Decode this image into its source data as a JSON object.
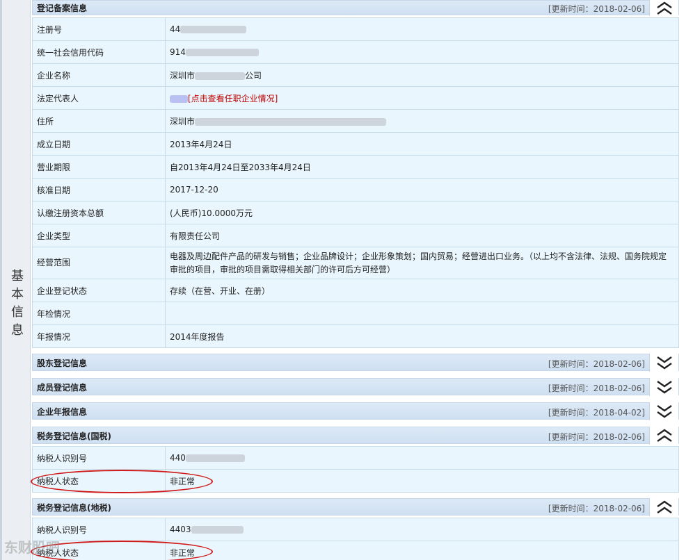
{
  "sidebar": {
    "label_chars": [
      "基",
      "本",
      "信",
      "息"
    ]
  },
  "sections": {
    "registration": {
      "title": "登记备案信息",
      "updated": "[更新时间：2018-02-06]",
      "expanded": true,
      "rows": [
        {
          "label": "注册号",
          "value": "44"
        },
        {
          "label": "统一社会信用代码",
          "value": "914"
        },
        {
          "label": "企业名称",
          "value_prefix": "深圳市",
          "value_suffix": "公司"
        },
        {
          "label": "法定代表人",
          "link": "[点击查看任职企业情况]"
        },
        {
          "label": "住所",
          "value": "深圳市"
        },
        {
          "label": "成立日期",
          "value": "2013年4月24日"
        },
        {
          "label": "营业期限",
          "value": "自2013年4月24日至2033年4月24日"
        },
        {
          "label": "核准日期",
          "value": "2017-12-20"
        },
        {
          "label": "认缴注册资本总额",
          "value": "(人民币)10.0000万元"
        },
        {
          "label": "企业类型",
          "value": "有限责任公司"
        },
        {
          "label": "经营范围",
          "value": "电器及周边配件产品的研发与销售；企业品牌设计；企业形象策划；国内贸易；经营进出口业务。（以上均不含法律、法规、国务院规定审批的项目，审批的项目需取得相关部门的许可后方可经营）"
        },
        {
          "label": "企业登记状态",
          "value": "存续（在营、开业、在册）"
        },
        {
          "label": "年检情况",
          "value": ""
        },
        {
          "label": "年报情况",
          "value": "2014年度报告"
        }
      ]
    },
    "shareholders": {
      "title": "股东登记信息",
      "updated": "[更新时间：2018-02-06]",
      "expanded": false
    },
    "members": {
      "title": "成员登记信息",
      "updated": "[更新时间：2018-02-06]",
      "expanded": false
    },
    "annual_report": {
      "title": "企业年报信息",
      "updated": "[更新时间：2018-04-02]",
      "expanded": false
    },
    "tax_national": {
      "title": "税务登记信息(国税)",
      "updated": "[更新时间：2018-02-06]",
      "expanded": true,
      "rows": [
        {
          "label": "纳税人识别号",
          "value": "440"
        },
        {
          "label": "纳税人状态",
          "value": "非正常"
        }
      ]
    },
    "tax_local": {
      "title": "税务登记信息(地税)",
      "updated": "[更新时间：2018-02-06]",
      "expanded": true,
      "rows": [
        {
          "label": "纳税人识别号",
          "value": "4403"
        },
        {
          "label": "纳税人状态",
          "value": "非正常"
        }
      ]
    }
  },
  "icons": {
    "collapse": "double-chevron-up-icon",
    "expand": "double-chevron-down-icon"
  },
  "colors": {
    "link": "#c00000",
    "highlight_oval": "#d11a1a",
    "header_bg": "#cfe0f2",
    "row_bg": "#e9f6fd"
  },
  "watermark": "东财股吧"
}
